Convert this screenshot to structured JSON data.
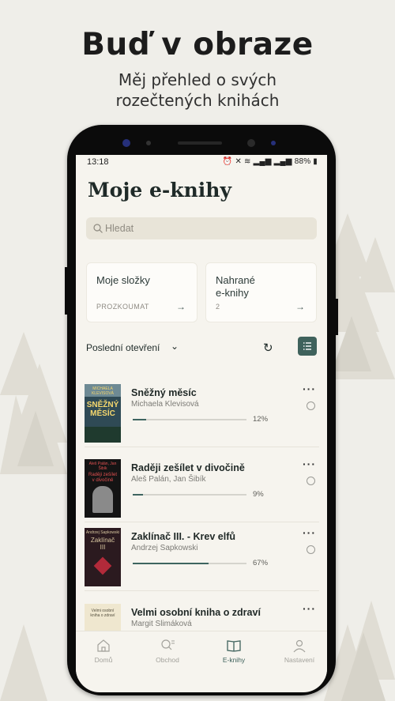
{
  "promo": {
    "headline": "Buď v obraze",
    "subline_1": "Měj přehled o svých",
    "subline_2": "rozečtených knihách"
  },
  "status_bar": {
    "time": "13:18",
    "battery": "88%"
  },
  "page_title": "Moje e-knihy",
  "search": {
    "placeholder": "Hledat"
  },
  "cards": [
    {
      "label": "Moje složky",
      "sub": "PROZKOUMAT"
    },
    {
      "label_1": "Nahrané",
      "label_2": "e-knihy",
      "sub": "2"
    }
  ],
  "sort": {
    "label": "Poslední otevření"
  },
  "books": [
    {
      "title": "Sněžný měsíc",
      "author": "Michaela Klevisová",
      "progress": 12,
      "progress_label": "12%",
      "cover_top": "MICHAELA KLEVISOVÁ",
      "cover_main_1": "SNĚŽNÝ",
      "cover_main_2": "MĚSÍC"
    },
    {
      "title": "Raději zešílet v divočině",
      "author": "Aleš Palán, Jan Šibík",
      "progress": 9,
      "progress_label": "9%",
      "cover_top": "Aleš Palán, Jan Šibík",
      "cover_main_1": "Raději zešílet",
      "cover_main_2": "v divočině"
    },
    {
      "title": "Zaklínač III. - Krev elfů",
      "author": "Andrzej Sapkowski",
      "progress": 67,
      "progress_label": "67%",
      "cover_top": "Andrzej Sapkowski",
      "cover_main_1": "Zaklínač",
      "cover_main_2": "III"
    },
    {
      "title": "Velmi osobní kniha o zdraví",
      "author": "Margit Slimáková",
      "progress": 0,
      "progress_label": "",
      "cover_top": "",
      "cover_main_1": "Velmi osobní",
      "cover_main_2": "kniha o zdraví"
    }
  ],
  "nav": [
    {
      "label": "Domů",
      "icon": "home-icon"
    },
    {
      "label": "Obchod",
      "icon": "shop-search-icon"
    },
    {
      "label": "E-knihy",
      "icon": "open-book-icon",
      "active": true
    },
    {
      "label": "Nastavení",
      "icon": "person-icon"
    }
  ],
  "colors": {
    "accent": "#3f625c",
    "background": "#f6f4ee",
    "search_bg": "#e8e4d8"
  }
}
